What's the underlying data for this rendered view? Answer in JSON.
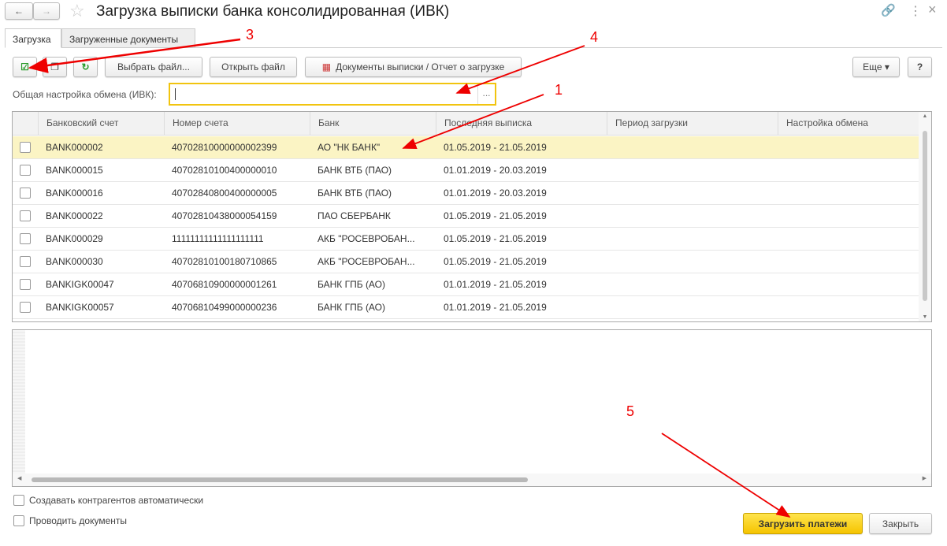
{
  "window": {
    "title": "Загрузка выписки банка консолидированная (ИВК)"
  },
  "tabs": [
    {
      "label": "Загрузка"
    },
    {
      "label": "Загруженные документы"
    }
  ],
  "toolbar": {
    "select_file": "Выбрать файл...",
    "open_file": "Открыть файл",
    "docs_report": "Документы выписки / Отчет о загрузке",
    "more": "Еще",
    "help": "?"
  },
  "field": {
    "label": "Общая настройка обмена (ИВК):",
    "value": "",
    "choose": "..."
  },
  "table": {
    "headers": [
      "Банковский счет",
      "Номер счета",
      "Банк",
      "Последняя выписка",
      "Период загрузки",
      "Настройка обмена"
    ],
    "rows": [
      [
        "BANK000002",
        "40702810000000002399",
        "АО \"НК БАНК\"",
        "01.05.2019 - 21.05.2019",
        "",
        ""
      ],
      [
        "BANK000015",
        "40702810100400000010",
        "БАНК ВТБ (ПАО)",
        "01.01.2019 - 20.03.2019",
        "",
        ""
      ],
      [
        "BANK000016",
        "40702840800400000005",
        "БАНК ВТБ (ПАО)",
        "01.01.2019 - 20.03.2019",
        "",
        ""
      ],
      [
        "BANK000022",
        "40702810438000054159",
        "ПАО СБЕРБАНК",
        "01.05.2019 - 21.05.2019",
        "",
        ""
      ],
      [
        "BANK000029",
        "11111111111111111111",
        "АКБ \"РОСЕВРОБАН...",
        "01.05.2019 - 21.05.2019",
        "",
        ""
      ],
      [
        "BANK000030",
        "40702810100180710865",
        "АКБ \"РОСЕВРОБАН...",
        "01.05.2019 - 21.05.2019",
        "",
        ""
      ],
      [
        "BANKIGK00047",
        "40706810900000001261",
        "БАНК ГПБ (АО)",
        "01.01.2019 - 21.05.2019",
        "",
        ""
      ],
      [
        "BANKIGK00057",
        "40706810499000000236",
        "БАНК ГПБ (АО)",
        "01.01.2019 - 21.05.2019",
        "",
        ""
      ]
    ]
  },
  "options": {
    "auto_contractors": "Создавать контрагентов автоматически",
    "post_documents": "Проводить документы"
  },
  "footer": {
    "load": "Загрузить платежи",
    "close": "Закрыть"
  },
  "annotations": [
    "1",
    "3",
    "4",
    "5"
  ]
}
